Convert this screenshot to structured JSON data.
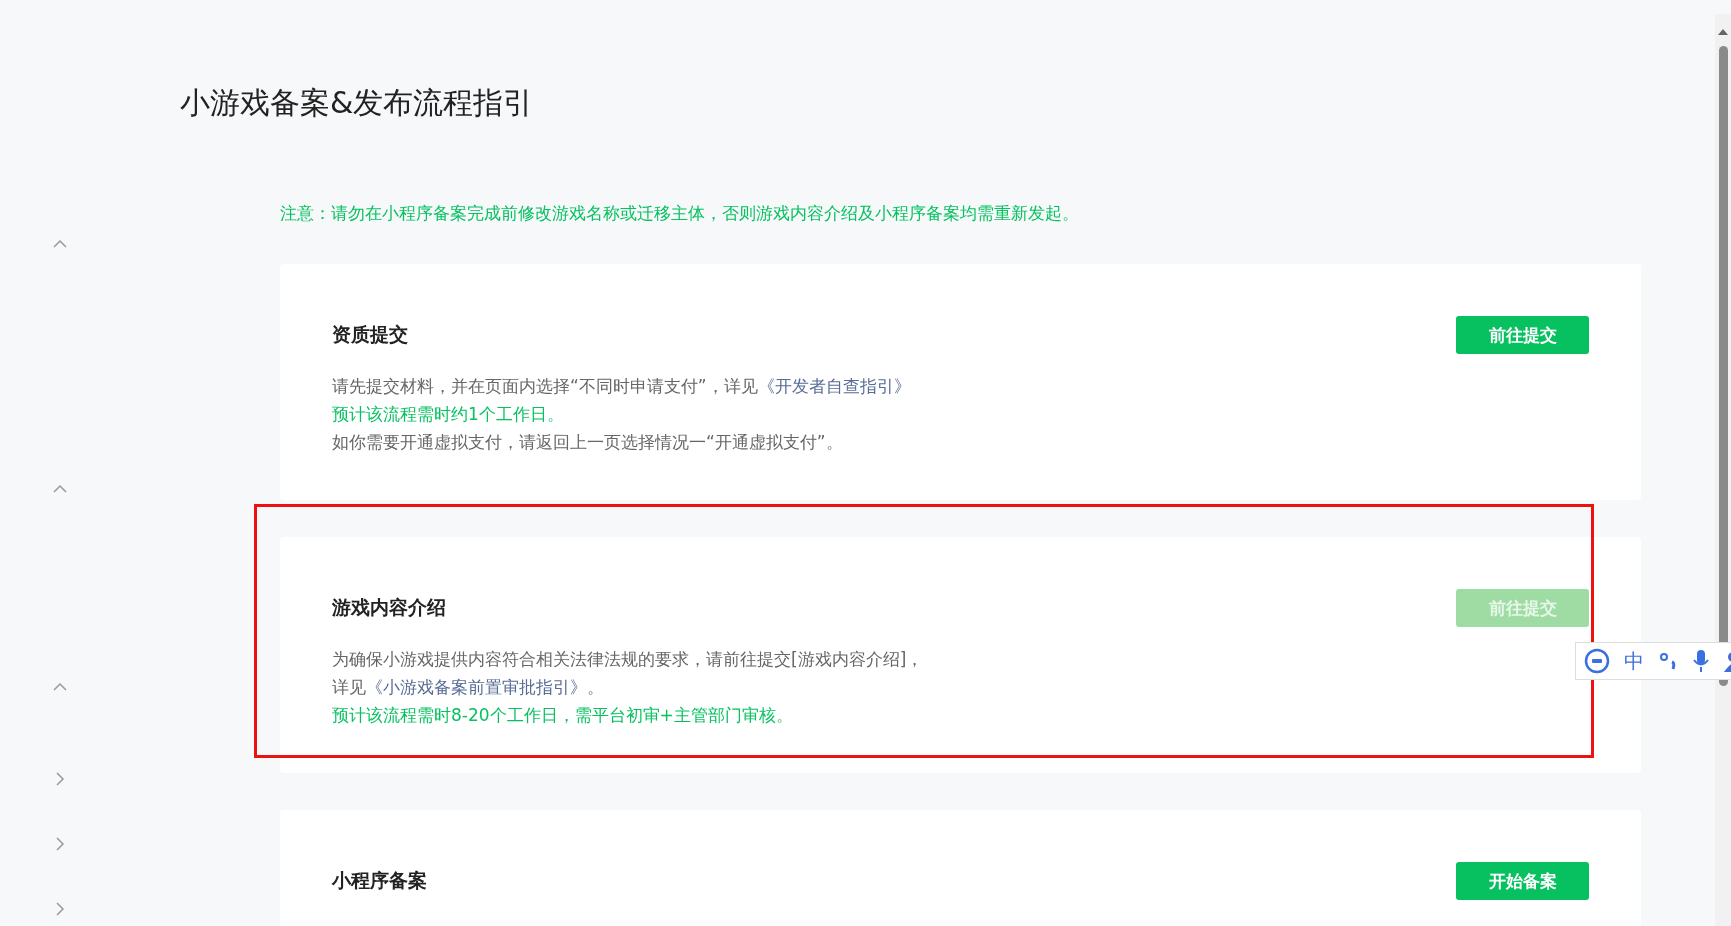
{
  "page_title": "小游戏备案&发布流程指引",
  "notice": "注意：请勿在小程序备案完成前修改游戏名称或迁移主体，否则游戏内容介绍及小程序备案均需重新发起。",
  "nav_toggles": [
    {
      "expanded": true
    },
    {
      "expanded": true
    },
    {
      "expanded": true
    },
    {
      "expanded": false
    },
    {
      "expanded": false
    },
    {
      "expanded": false
    }
  ],
  "sections": [
    {
      "title": "资质提交",
      "button": {
        "label": "前往提交",
        "disabled": false
      },
      "highlighted": false,
      "lines": [
        {
          "emphasized": false,
          "parts": [
            {
              "text": "请先提交材料，并在页面内选择“不同时申请支付”，详见",
              "link": false
            },
            {
              "text": "《开发者自查指引》",
              "link": true
            }
          ]
        },
        {
          "emphasized": true,
          "parts": [
            {
              "text": "预计该流程需时约1个工作日。",
              "link": false
            }
          ]
        },
        {
          "emphasized": false,
          "parts": [
            {
              "text": "如你需要开通虚拟支付，请返回上一页选择情况一“开通虚拟支付”。",
              "link": false
            }
          ]
        }
      ]
    },
    {
      "title": "游戏内容介绍",
      "button": {
        "label": "前往提交",
        "disabled": true
      },
      "highlighted": true,
      "lines": [
        {
          "emphasized": false,
          "parts": [
            {
              "text": "为确保小游戏提供内容符合相关法律法规的要求，请前往提交[游戏内容介绍]，",
              "link": false
            }
          ]
        },
        {
          "emphasized": false,
          "parts": [
            {
              "text": "详见",
              "link": false
            },
            {
              "text": "《小游戏备案前置审批指引》",
              "link": true
            },
            {
              "text": "。",
              "link": false
            }
          ]
        },
        {
          "emphasized": true,
          "parts": [
            {
              "text": "预计该流程需时8-20个工作日，需平台初审+主管部门审核。",
              "link": false
            }
          ]
        }
      ]
    },
    {
      "title": "小程序备案",
      "button": {
        "label": "开始备案",
        "disabled": false
      },
      "highlighted": false
    }
  ],
  "ime_toolbar": {
    "mode": "中"
  }
}
